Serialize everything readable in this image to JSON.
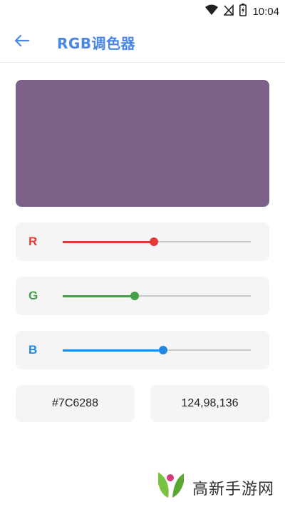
{
  "status_bar": {
    "time": "10:04",
    "icons": [
      "wifi-icon",
      "no-signal-icon",
      "battery-icon"
    ]
  },
  "app_bar": {
    "back_icon": "arrow-left-icon",
    "title": "RGB调色器"
  },
  "preview": {
    "color": "#7C6288"
  },
  "sliders": [
    {
      "label": "R",
      "color": "#e53935",
      "value": 124,
      "max": 255
    },
    {
      "label": "G",
      "color": "#43a047",
      "value": 98,
      "max": 255
    },
    {
      "label": "B",
      "color": "#1e88e5",
      "value": 136,
      "max": 255
    }
  ],
  "values": {
    "hex": "#7C6288",
    "rgb": "124,98,136"
  },
  "watermark": {
    "text": "高新手游网"
  },
  "colors": {
    "accent": "#4a86e8",
    "track": "#c8c8c8",
    "card_bg": "#f5f5f5"
  }
}
